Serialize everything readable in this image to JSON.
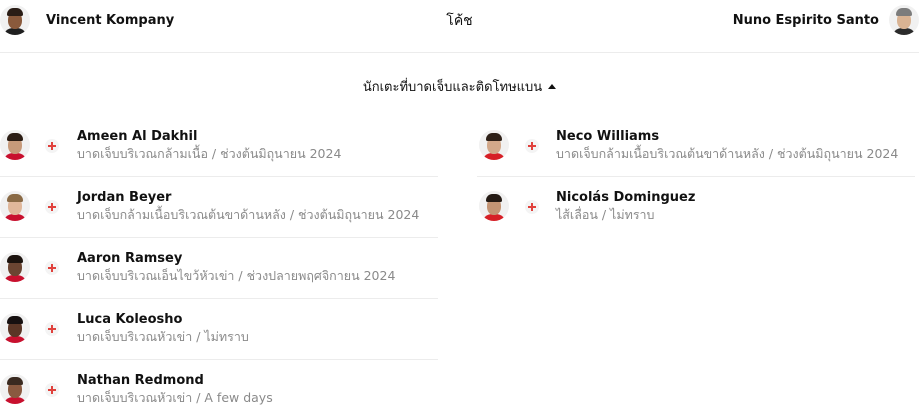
{
  "coaches": {
    "label": "โค้ช",
    "home": {
      "name": "Vincent Kompany",
      "avatar_icon": "person-photo-icon"
    },
    "away": {
      "name": "Nuno Espirito Santo",
      "avatar_icon": "person-photo-icon"
    }
  },
  "injuries": {
    "title": "นักเตะที่บาดเจ็บและติดโทษแบน",
    "collapse_icon": "caret-up-icon",
    "status_icon": "injury-cross-icon",
    "status_color": "#e0413c",
    "home": [
      {
        "name": "Ameen Al Dakhil",
        "status": "บาดเจ็บบริเวณกล้ามเนื้อ / ช่วงต้นมิถุนายน 2024"
      },
      {
        "name": "Jordan Beyer",
        "status": "บาดเจ็บกล้ามเนื้อบริเวณต้นขาด้านหลัง / ช่วงต้นมิถุนายน 2024"
      },
      {
        "name": "Aaron Ramsey",
        "status": "บาดเจ็บบริเวณเอ็นไขว้หัวเข่า / ช่วงปลายพฤศจิกายน 2024"
      },
      {
        "name": "Luca Koleosho",
        "status": "บาดเจ็บบริเวณหัวเข่า / ไม่ทราบ"
      },
      {
        "name": "Nathan Redmond",
        "status": "บาดเจ็บบริเวณหัวเข่า / A few days"
      }
    ],
    "away": [
      {
        "name": "Neco Williams",
        "status": "บาดเจ็บกล้ามเนื้อบริเวณต้นขาด้านหลัง / ช่วงต้นมิถุนายน 2024"
      },
      {
        "name": "Nicolás Dominguez",
        "status": "ไส้เลื่อน / ไม่ทราบ"
      }
    ]
  }
}
